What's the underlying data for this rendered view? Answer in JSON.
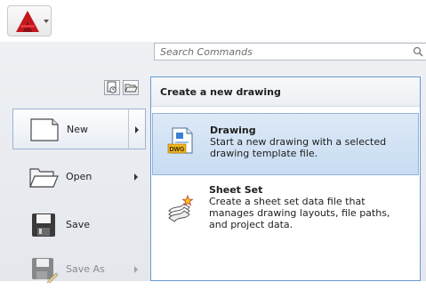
{
  "app_button": {
    "icon": "autocad-logo-icon"
  },
  "search": {
    "placeholder": "Search Commands",
    "value": ""
  },
  "view_buttons": [
    {
      "icon": "recent-documents-icon"
    },
    {
      "icon": "open-documents-icon"
    }
  ],
  "left_menu": {
    "items": [
      {
        "label": "New",
        "icon": "new-file-icon",
        "has_submenu": true,
        "selected": true,
        "disabled": false
      },
      {
        "label": "Open",
        "icon": "open-folder-icon",
        "has_submenu": true,
        "selected": false,
        "disabled": false
      },
      {
        "label": "Save",
        "icon": "save-icon",
        "has_submenu": false,
        "selected": false,
        "disabled": false
      },
      {
        "label": "Save As",
        "icon": "save-as-icon",
        "has_submenu": true,
        "selected": false,
        "disabled": true
      }
    ]
  },
  "flyout": {
    "title": "Create a new drawing",
    "options": [
      {
        "title": "Drawing",
        "description": "Start a new drawing with a selected drawing template file.",
        "icon": "dwg-drawing-icon",
        "icon_text": "DWG",
        "active": true
      },
      {
        "title": "Sheet Set",
        "description": "Create a sheet set data file that manages drawing layouts, file paths, and project data.",
        "icon": "sheet-set-icon",
        "active": false
      }
    ]
  },
  "colors": {
    "accent_blue": "#c8dcf2",
    "brand_red": "#c4161c"
  }
}
